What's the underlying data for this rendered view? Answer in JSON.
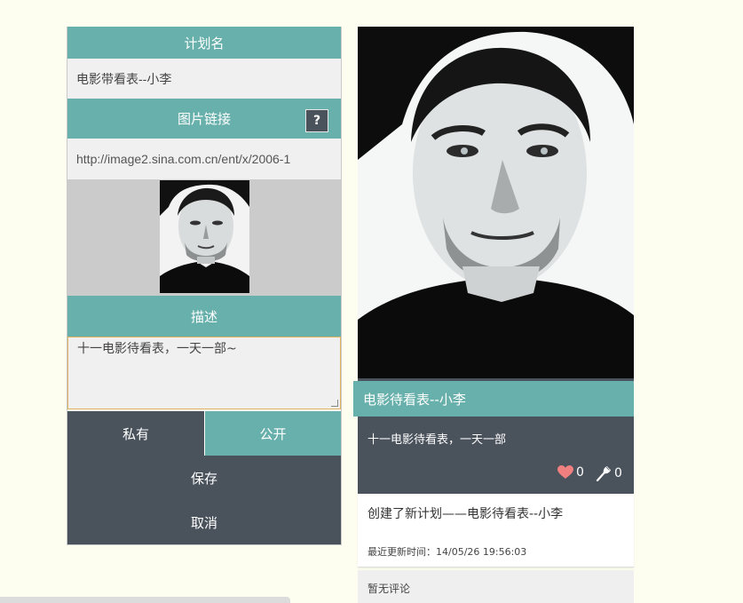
{
  "form": {
    "plan_name_header": "计划名",
    "plan_name_value": "电影带看表--小李",
    "image_link_header": "图片链接",
    "help_label": "?",
    "image_url_value": "http://image2.sina.com.cn/ent/x/2006-1",
    "description_header": "描述",
    "description_value": "十一电影待看表，一天一部~",
    "private_label": "私有",
    "public_label": "公开",
    "selected_visibility": "公开",
    "save_label": "保存",
    "cancel_label": "取消"
  },
  "card": {
    "title": "电影待看表--小李",
    "description": "十一电影待看表，一天一部",
    "likes": "0",
    "forks": "0",
    "activity": "创建了新计划——电影待看表--小李",
    "updated": "最近更新时间：14/05/26 19:56:03",
    "comments_empty": "暂无评论"
  },
  "icons": {
    "like": "heart-icon",
    "fork": "fork-icon",
    "help": "question-icon"
  },
  "colors": {
    "teal": "#68b0ab",
    "dark": "#4a525c",
    "field_bg": "#f0f0f0",
    "page_bg": "#fefef0",
    "heart": "#f07f7f"
  }
}
